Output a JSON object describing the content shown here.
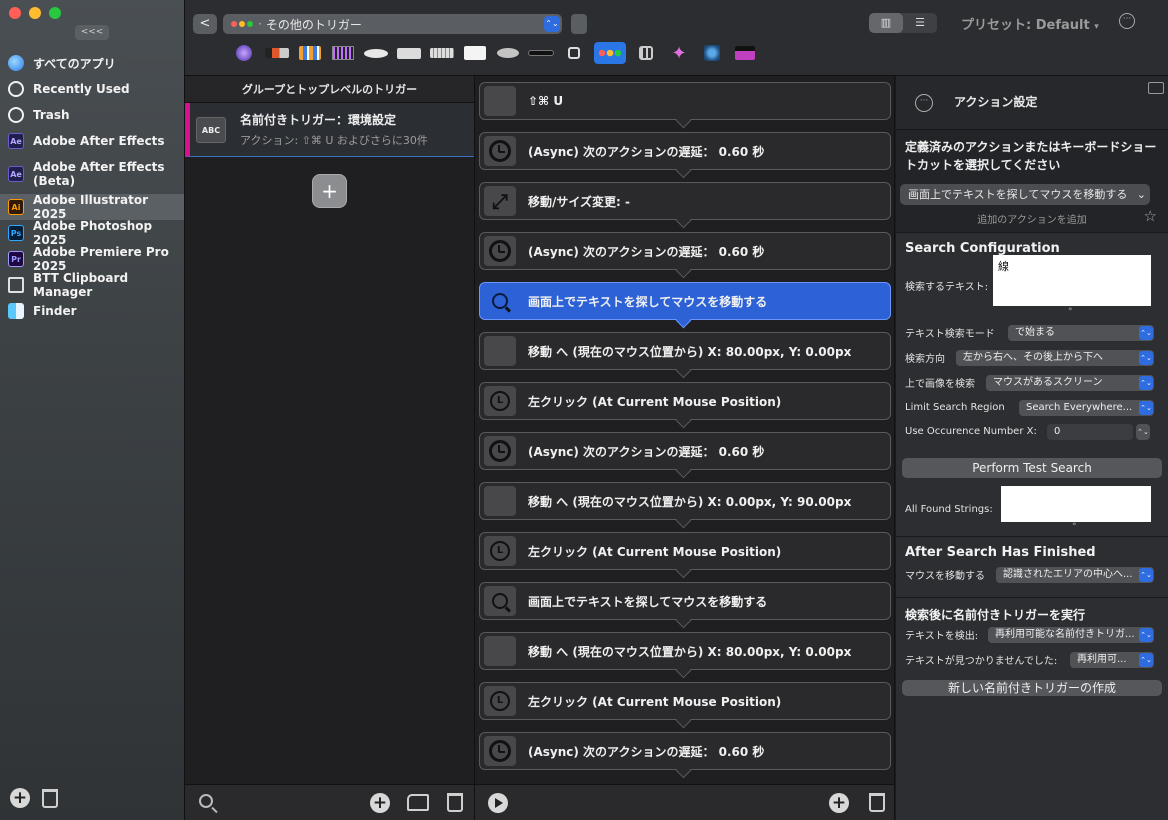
{
  "sidebar": {
    "collapse_label": "<<<",
    "apps": [
      {
        "name": "すべてのアプリ",
        "icon": "globe-icon"
      },
      {
        "name": "Recently Used",
        "icon": "clock-icon"
      },
      {
        "name": "Trash",
        "icon": "trash-icon"
      },
      {
        "name": "Adobe After Effects",
        "icon": "after-effects-icon",
        "badge": "Ae"
      },
      {
        "name": "Adobe After Effects (Beta)",
        "icon": "after-effects-beta-icon",
        "badge": "Ae"
      },
      {
        "name": "Adobe Illustrator 2025",
        "icon": "illustrator-icon",
        "badge": "Ai"
      },
      {
        "name": "Adobe Photoshop 2025",
        "icon": "photoshop-icon",
        "badge": "Ps"
      },
      {
        "name": "Adobe Premiere Pro 2025",
        "icon": "premiere-icon",
        "badge": "Pr"
      },
      {
        "name": "BTT Clipboard Manager",
        "icon": "clipboard-manager-icon"
      },
      {
        "name": "Finder",
        "icon": "finder-icon"
      }
    ],
    "selected_app": "Adobe Illustrator 2025"
  },
  "toolbar": {
    "back_label": "<",
    "trigger_type": "その他のトリガー",
    "preset_label": "プリセット: Default",
    "preset_arrow": "▾",
    "more_label": "···",
    "accent": "#2e6ce0"
  },
  "groups": {
    "header": "グループとトップレベルのトリガー",
    "named_trigger_title": "名前付きトリガー：環境設定",
    "named_trigger_sub": "アクション: ⇧⌘ U およびさらに30件",
    "badge": "ABC",
    "add_label": "+"
  },
  "actions": [
    {
      "label": "⇧⌘ U",
      "icon": "blank-icon"
    },
    {
      "label": "(Async) 次のアクションの遅延： 0.60 秒",
      "icon": "clock-icon"
    },
    {
      "label": "移動/サイズ変更: -",
      "icon": "resize-icon"
    },
    {
      "label": "(Async) 次のアクションの遅延： 0.60 秒",
      "icon": "clock-icon"
    },
    {
      "label": "画面上でテキストを探してマウスを移動する",
      "icon": "magnifier-icon",
      "active": true
    },
    {
      "label": "移動 へ (現在のマウス位置から) X: 80.00px, Y: 0.00px",
      "icon": "blank-icon"
    },
    {
      "label": "左クリック (At Current Mouse Position)",
      "icon": "left-click-icon"
    },
    {
      "label": "(Async) 次のアクションの遅延： 0.60 秒",
      "icon": "clock-icon"
    },
    {
      "label": "移動 へ (現在のマウス位置から) X: 0.00px, Y: 90.00px",
      "icon": "blank-icon"
    },
    {
      "label": "左クリック (At Current Mouse Position)",
      "icon": "left-click-icon"
    },
    {
      "label": "画面上でテキストを探してマウスを移動する",
      "icon": "magnifier-icon"
    },
    {
      "label": "移動 へ (現在のマウス位置から) X: 80.00px, Y: 0.00px",
      "icon": "blank-icon"
    },
    {
      "label": "左クリック (At Current Mouse Position)",
      "icon": "left-click-icon"
    },
    {
      "label": "(Async) 次のアクションの遅延： 0.60 秒",
      "icon": "clock-icon"
    }
  ],
  "config": {
    "title": "アクション設定",
    "more_label": "···",
    "desc": "定義済みのアクションまたはキーボードショートカットを選択してください",
    "selected_action": "画面上でテキストを探してマウスを移動する",
    "add_action_note": "追加のアクションを追加",
    "star": "☆",
    "search_config_heading": "Search Configuration",
    "search_text_label": "検索するテキスト:",
    "search_text_value": "線",
    "handle": "°",
    "mode_label": "テキスト検索モード",
    "mode_value": "で始まる",
    "direction_label": "検索方向",
    "direction_value": "左から右へ、その後上から下へ",
    "image_label": "上で画像を検索",
    "image_value": "マウスがあるスクリーン",
    "region_label": "Limit Search Region",
    "region_value": "Search Everywhere...",
    "occurence_label": "Use Occurence Number X:",
    "occurence_value": "0",
    "stepper": "⌃⌄",
    "test_button": "Perform Test Search",
    "found_label": "All Found Strings:",
    "after_heading": "After Search Has Finished",
    "move_label": "マウスを移動する",
    "move_value": "認識されたエリアの中心へ...",
    "named_heading": "検索後に名前付きトリガーを実行",
    "found_text_label": "テキストを検出:",
    "found_text_value": "再利用可能な名前付きトリガ...",
    "not_found_label": "テキストが見つかりませんでした:",
    "not_found_value": "再利用可...",
    "new_trigger_button": "新しい名前付きトリガーの作成"
  },
  "popup_arrow": "⌃⌄",
  "select_arrow": "⌃⌄",
  "plus_label": "+"
}
